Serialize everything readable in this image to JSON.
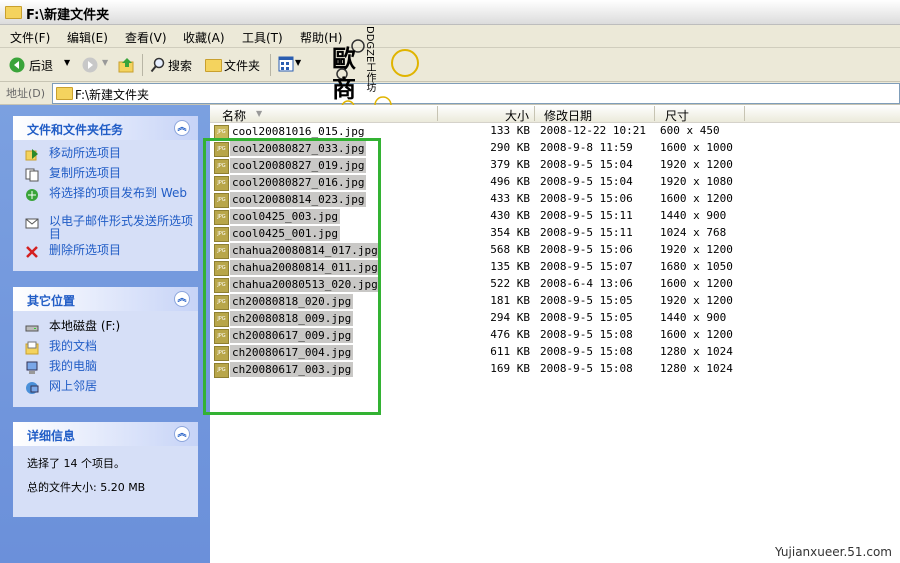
{
  "window": {
    "title": "F:\\新建文件夹"
  },
  "menubar": {
    "items": [
      "文件(F)",
      "编辑(E)",
      "查看(V)",
      "收藏(A)",
      "工具(T)",
      "帮助(H)"
    ]
  },
  "toolbar": {
    "back_label": "后退",
    "search_label": "搜索",
    "folders_label": "文件夹"
  },
  "addressbar": {
    "label": "地址(D)",
    "path": "F:\\新建文件夹"
  },
  "logo": {
    "text_main": "歐 商",
    "text_side": "DDGZE工作坊"
  },
  "tasks_panel": {
    "title": "文件和文件夹任务",
    "items": [
      {
        "label": "移动所选项目",
        "icon": "move-icon"
      },
      {
        "label": "复制所选项目",
        "icon": "copy-icon"
      },
      {
        "label": "将选择的项目发布到 Web",
        "icon": "publish-web-icon"
      },
      {
        "label": "以电子邮件形式发送所选项目",
        "icon": "email-icon"
      },
      {
        "label": "删除所选项目",
        "icon": "delete-icon"
      }
    ]
  },
  "places_panel": {
    "title": "其它位置",
    "items": [
      {
        "label": "本地磁盘 (F:)",
        "icon": "drive-icon"
      },
      {
        "label": "我的文档",
        "icon": "documents-icon"
      },
      {
        "label": "我的电脑",
        "icon": "computer-icon"
      },
      {
        "label": "网上邻居",
        "icon": "network-icon"
      }
    ]
  },
  "details_panel": {
    "title": "详细信息",
    "selected_text": "选择了 14 个项目。",
    "size_text": "总的文件大小: 5.20 MB"
  },
  "columns": {
    "name": "名称",
    "size": "大小",
    "modified": "修改日期",
    "dimensions": "尺寸"
  },
  "files": [
    {
      "name": "cool20081016_015.jpg",
      "size": "133 KB",
      "date": "2008-12-22 10:21",
      "dim": "600 x 450",
      "selected": false
    },
    {
      "name": "cool20080827_033.jpg",
      "size": "290 KB",
      "date": "2008-9-8 11:59",
      "dim": "1600 x 1000",
      "selected": true
    },
    {
      "name": "cool20080827_019.jpg",
      "size": "379 KB",
      "date": "2008-9-5 15:04",
      "dim": "1920 x 1200",
      "selected": true
    },
    {
      "name": "cool20080827_016.jpg",
      "size": "496 KB",
      "date": "2008-9-5 15:04",
      "dim": "1920 x 1080",
      "selected": true
    },
    {
      "name": "cool20080814_023.jpg",
      "size": "433 KB",
      "date": "2008-9-5 15:06",
      "dim": "1600 x 1200",
      "selected": true
    },
    {
      "name": "cool0425_003.jpg",
      "size": "430 KB",
      "date": "2008-9-5 15:11",
      "dim": "1440 x 900",
      "selected": true
    },
    {
      "name": "cool0425_001.jpg",
      "size": "354 KB",
      "date": "2008-9-5 15:11",
      "dim": "1024 x 768",
      "selected": true
    },
    {
      "name": "chahua20080814_017.jpg",
      "size": "568 KB",
      "date": "2008-9-5 15:06",
      "dim": "1920 x 1200",
      "selected": true
    },
    {
      "name": "chahua20080814_011.jpg",
      "size": "135 KB",
      "date": "2008-9-5 15:07",
      "dim": "1680 x 1050",
      "selected": true
    },
    {
      "name": "chahua20080513_020.jpg",
      "size": "522 KB",
      "date": "2008-6-4 13:06",
      "dim": "1600 x 1200",
      "selected": true
    },
    {
      "name": "ch20080818_020.jpg",
      "size": "181 KB",
      "date": "2008-9-5 15:05",
      "dim": "1920 x 1200",
      "selected": true
    },
    {
      "name": "ch20080818_009.jpg",
      "size": "294 KB",
      "date": "2008-9-5 15:05",
      "dim": "1440 x 900",
      "selected": true
    },
    {
      "name": "ch20080617_009.jpg",
      "size": "476 KB",
      "date": "2008-9-5 15:08",
      "dim": "1600 x 1200",
      "selected": true
    },
    {
      "name": "ch20080617_004.jpg",
      "size": "611 KB",
      "date": "2008-9-5 15:08",
      "dim": "1280 x 1024",
      "selected": true
    },
    {
      "name": "ch20080617_003.jpg",
      "size": "169 KB",
      "date": "2008-9-5 15:08",
      "dim": "1280 x 1024",
      "selected": true
    }
  ],
  "file_icon_text": "JPG",
  "watermark": "Yujianxueer.51.com",
  "colors": {
    "highlight_box": "#33b233",
    "selection": "#c9c8c6",
    "link": "#215dc6"
  }
}
